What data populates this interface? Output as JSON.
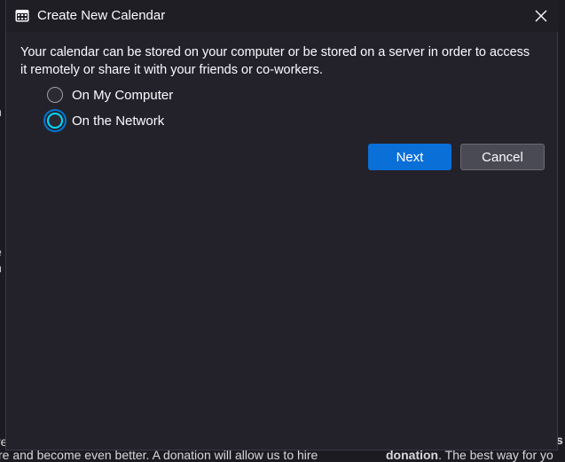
{
  "window": {
    "title": "Create New Calendar",
    "close_glyph": "✕"
  },
  "body": {
    "description": "Your calendar can be stored on your computer or be stored on a server in order to access it remotely or share it with your friends or co-workers."
  },
  "options": [
    {
      "label": "On My Computer",
      "checked": false
    },
    {
      "label": "On the Network",
      "checked": true
    }
  ],
  "buttons": {
    "next": "Next",
    "cancel": "Cancel"
  },
  "background_fragments": {
    "bottom_left": "re and become even better. A donation will allow us to hire",
    "bottom_right_bold": "donation",
    "bottom_right": ". The best way for yo"
  },
  "colors": {
    "accent": "#0b6fd8",
    "radio_focus": "#00ddff",
    "dialog_bg": "#23222b"
  }
}
